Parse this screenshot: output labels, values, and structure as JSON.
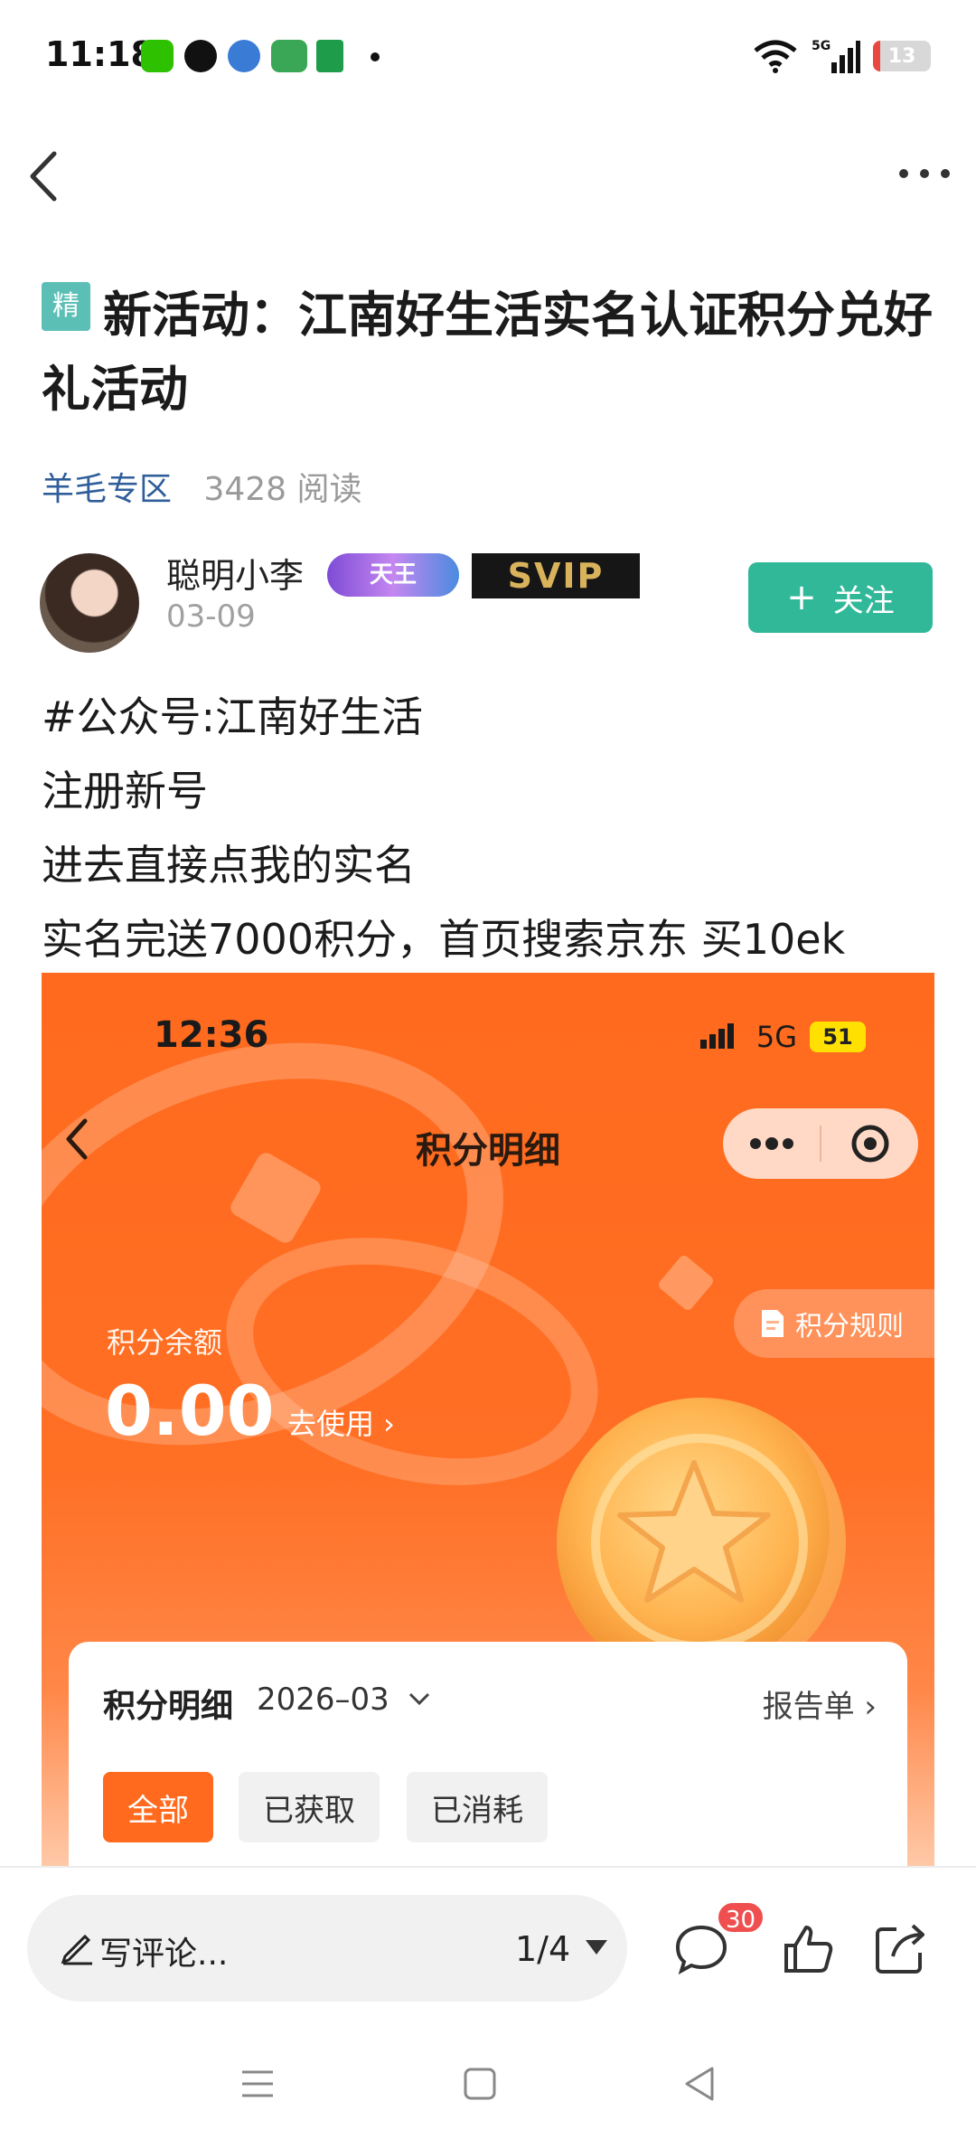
{
  "status_bar": {
    "time": "11:18",
    "battery": "13",
    "battery_level": 0.13,
    "network": "5G",
    "apps": [
      "wechat-icon",
      "qq-icon",
      "browser-icon",
      "oppo-icon",
      "post-icon"
    ]
  },
  "nav": {
    "back_icon": "chevron-left-icon",
    "more_icon": "more-dots-icon"
  },
  "article": {
    "tag": "精",
    "title": "新活动：江南好生活实名认证积分兑好礼活动",
    "category": "羊毛专区",
    "reads": "3428 阅读",
    "author": {
      "name": "聪明小李",
      "badge_title": "天王",
      "badge_vip": "SVIP",
      "date": "03-09",
      "follow_label": "关注"
    },
    "lines": [
      "#公众号:江南好生活",
      "注册新号",
      "进去直接点我的实名",
      "实名完送7000积分，首页搜索京东 买10ek"
    ]
  },
  "embedded": {
    "time": "12:36",
    "network": "5G",
    "battery": "51",
    "page_title": "积分明细",
    "rules_label": "积分规则",
    "balance_label": "积分余额",
    "balance": "0.00",
    "use_label": "去使用 ›",
    "card_title": "积分明细",
    "card_month": "2026–03",
    "report_label": "报告单 ›",
    "filters": [
      "全部",
      "已获取",
      "已消耗"
    ]
  },
  "bottom_bar": {
    "comment_placeholder": "写评论...",
    "page_indicator": "1/4",
    "comment_count": "30"
  },
  "colors": {
    "accent": "#31b898",
    "category": "#2f5e9a",
    "orange": "#ff6a1e",
    "badge_red": "#ef4f4f"
  }
}
